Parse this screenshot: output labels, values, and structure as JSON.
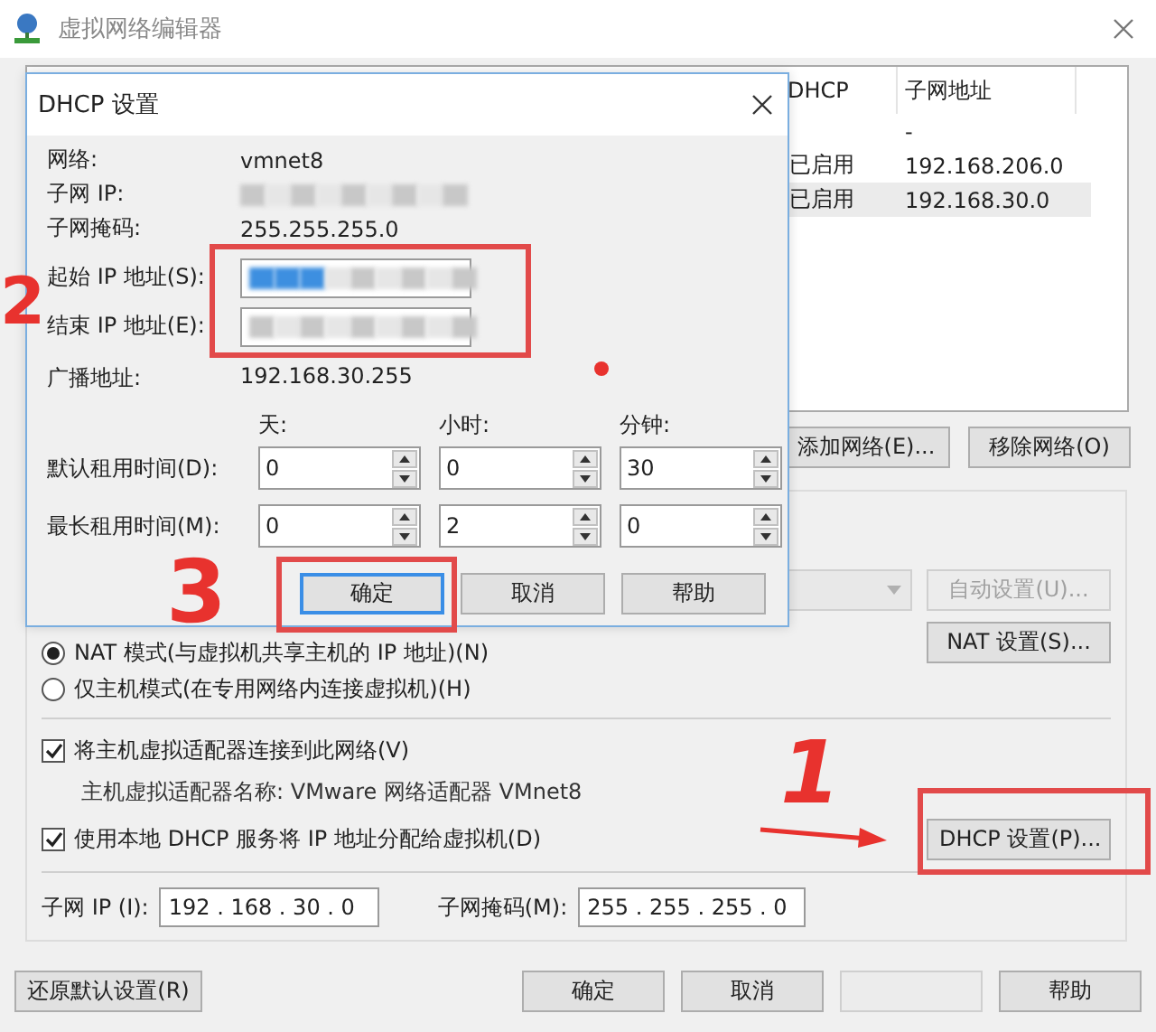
{
  "window": {
    "title": "虚拟网络编辑器"
  },
  "network_table": {
    "columns": [
      "DHCP",
      "子网地址"
    ],
    "rows": [
      {
        "subnet_address": "-",
        "selected": false
      },
      {
        "dhcp": "已启用",
        "subnet_address": "192.168.206.0",
        "selected": false
      },
      {
        "dhcp": "已启用",
        "subnet_address": "192.168.30.0",
        "selected": true
      }
    ]
  },
  "table_buttons": [
    "添加网络(E)...",
    "移除网络(O)"
  ],
  "bridge_select": {
    "disabled": true
  },
  "auto_settings_button": {
    "label": "自动设置(U)...",
    "disabled": true
  },
  "modes": [
    {
      "label": "NAT 模式(与虚拟机共享主机的 IP 地址)(N)",
      "selected": true
    },
    {
      "label": "仅主机模式(在专用网络内连接虚拟机)(H)",
      "selected": false
    }
  ],
  "nat_settings_button": "NAT 设置(S)...",
  "host_adapter": {
    "label": "将主机虚拟适配器连接到此网络(V)",
    "checked": true
  },
  "adapter_name": "主机虚拟适配器名称: VMware 网络适配器 VMnet8",
  "local_dhcp": {
    "label": "使用本地 DHCP 服务将 IP 地址分配给虚拟机(D)",
    "checked": true
  },
  "dhcp_settings_button": "DHCP 设置(P)...",
  "subnet_ip": {
    "label": "子网 IP (I):",
    "value": "192 . 168 . 30 . 0"
  },
  "subnet_mask": {
    "label": "子网掩码(M):",
    "value": "255 . 255 . 255 . 0"
  },
  "footer_buttons": [
    {
      "label": "还原默认设置(R)",
      "disabled": false
    },
    {
      "label": "确定",
      "disabled": false
    },
    {
      "label": "取消",
      "disabled": false
    },
    {
      "disabled": true
    },
    {
      "label": "帮助",
      "disabled": false
    }
  ],
  "dhcp_dialog": {
    "title": "DHCP 设置",
    "info": [
      {
        "label": "网络:",
        "value": "vmnet8",
        "redacted": false
      },
      {
        "label": "子网 IP:",
        "redacted": true
      },
      {
        "label": "子网掩码:",
        "value": "255.255.255.0",
        "redacted": false
      }
    ],
    "range": [
      {
        "label": "起始 IP 地址(S):",
        "redacted": true,
        "text_selected": true
      },
      {
        "label": "结束 IP 地址(E):",
        "redacted": true,
        "text_selected": false
      }
    ],
    "broadcast": {
      "label": "广播地址:",
      "value": "192.168.30.255"
    },
    "lease_units": [
      "天:",
      "小时:",
      "分钟:"
    ],
    "leases": [
      {
        "label": "默认租用时间(D):",
        "values": [
          "0",
          "0",
          "30"
        ]
      },
      {
        "label": "最长租用时间(M):",
        "values": [
          "0",
          "2",
          "0"
        ]
      }
    ],
    "buttons": [
      {
        "label": "确定",
        "focused": true
      },
      {
        "label": "取消",
        "focused": false
      },
      {
        "label": "帮助",
        "focused": false
      }
    ]
  },
  "annotations": [
    {
      "kind": "number",
      "label": "2"
    },
    {
      "kind": "number",
      "label": "3"
    },
    {
      "kind": "number",
      "label": "1"
    },
    {
      "kind": "arrow"
    },
    {
      "kind": "box"
    },
    {
      "kind": "box"
    },
    {
      "kind": "box"
    },
    {
      "kind": "dot"
    }
  ]
}
